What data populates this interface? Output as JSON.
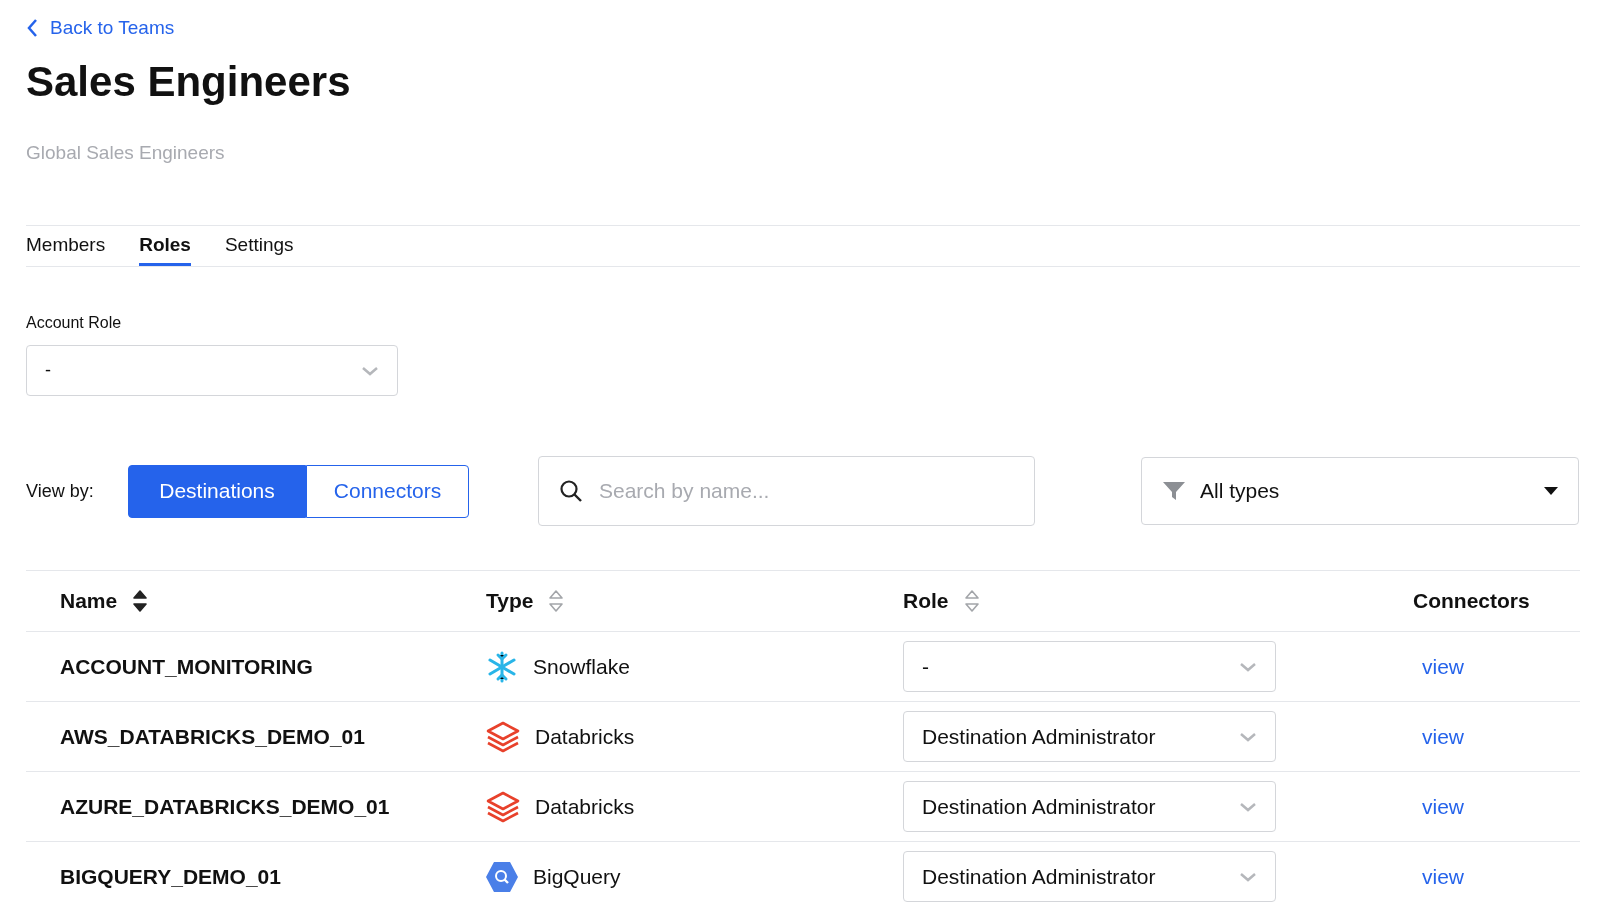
{
  "back_link": "Back to Teams",
  "title": "Sales Engineers",
  "subtitle": "Global Sales Engineers",
  "tabs": [
    {
      "label": "Members",
      "selected": false
    },
    {
      "label": "Roles",
      "selected": true
    },
    {
      "label": "Settings",
      "selected": false
    }
  ],
  "account_role": {
    "label": "Account Role",
    "value": "-"
  },
  "view_by": {
    "label": "View by:",
    "options": [
      {
        "label": "Destinations",
        "selected": true
      },
      {
        "label": "Connectors",
        "selected": false
      }
    ]
  },
  "search": {
    "placeholder": "Search by name..."
  },
  "type_filter": {
    "value": "All types"
  },
  "table": {
    "columns": [
      {
        "label": "Name",
        "sorted": true
      },
      {
        "label": "Type",
        "sorted": false
      },
      {
        "label": "Role",
        "sorted": false
      },
      {
        "label": "Connectors"
      }
    ],
    "rows": [
      {
        "name": "ACCOUNT_MONITORING",
        "type": "Snowflake",
        "kind": "snowflake",
        "role": "-",
        "link": "view"
      },
      {
        "name": "AWS_DATABRICKS_DEMO_01",
        "type": "Databricks",
        "kind": "databricks",
        "role": "Destination Administrator",
        "link": "view"
      },
      {
        "name": "AZURE_DATABRICKS_DEMO_01",
        "type": "Databricks",
        "kind": "databricks",
        "role": "Destination Administrator",
        "link": "view"
      },
      {
        "name": "BIGQUERY_DEMO_01",
        "type": "BigQuery",
        "kind": "bigquery",
        "role": "Destination Administrator",
        "link": "view"
      }
    ]
  }
}
